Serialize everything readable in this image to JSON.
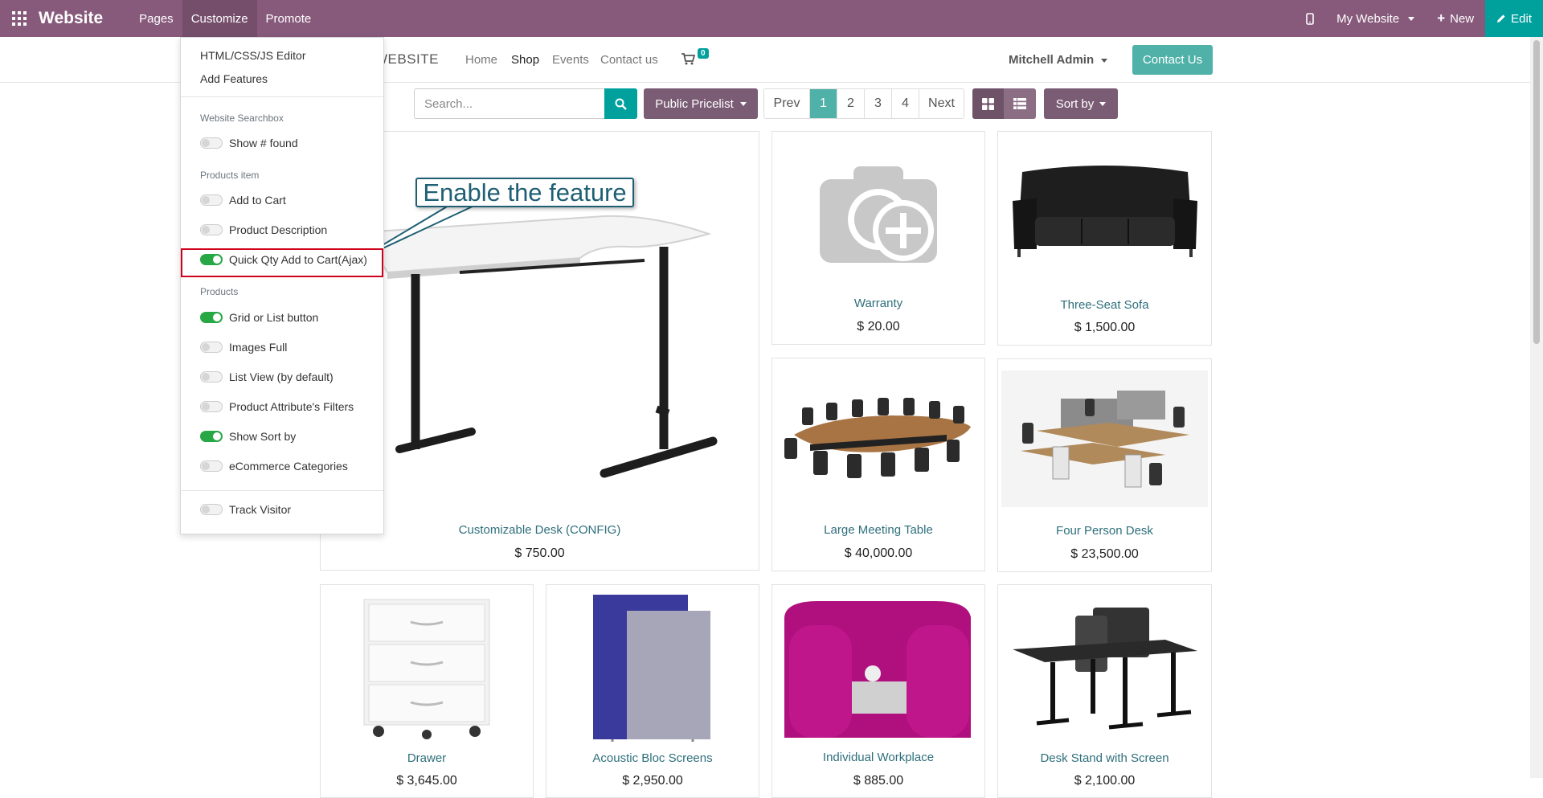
{
  "topbar": {
    "brand": "Website",
    "menus": [
      "Pages",
      "Customize",
      "Promote"
    ],
    "my_website": "My Website",
    "new_label": "New",
    "edit_label": "Edit"
  },
  "sitenav": {
    "logo": "WEBSITE",
    "links": [
      "Home",
      "Shop",
      "Events",
      "Contact us"
    ],
    "cart_count": "0",
    "user": "Mitchell Admin",
    "contact_button": "Contact Us"
  },
  "toolbar": {
    "search_placeholder": "Search...",
    "pricelist": "Public Pricelist",
    "pager": [
      "Prev",
      "1",
      "2",
      "3",
      "4",
      "Next"
    ],
    "current_page": "1",
    "sort": "Sort by"
  },
  "dropdown": {
    "editor": "HTML/CSS/JS Editor",
    "add_features": "Add Features",
    "section_searchbox": "Website Searchbox",
    "show_found": "Show # found",
    "section_products_item": "Products item",
    "add_to_cart": "Add to Cart",
    "product_description": "Product Description",
    "quick_qty": "Quick Qty Add to Cart(Ajax)",
    "section_products": "Products",
    "grid_list": "Grid or List button",
    "images_full": "Images Full",
    "list_view": "List View (by default)",
    "attr_filters": "Product Attribute's Filters",
    "show_sort": "Show Sort by",
    "ecom_categories": "eCommerce Categories",
    "track_visitor": "Track Visitor",
    "toggle_states": {
      "show_found": false,
      "add_to_cart": false,
      "product_description": false,
      "quick_qty": true,
      "grid_list": true,
      "images_full": false,
      "list_view": false,
      "attr_filters": false,
      "show_sort": true,
      "ecom_categories": false,
      "track_visitor": false
    }
  },
  "callout": "Enable the feature",
  "products": [
    {
      "name": "Customizable Desk (CONFIG)",
      "price": "$ 750.00"
    },
    {
      "name": "Warranty",
      "price": "$ 20.00"
    },
    {
      "name": "Three-Seat Sofa",
      "price": "$ 1,500.00"
    },
    {
      "name": "Large Meeting Table",
      "price": "$ 40,000.00"
    },
    {
      "name": "Four Person Desk",
      "price": "$ 23,500.00"
    },
    {
      "name": "Drawer",
      "price": "$ 3,645.00"
    },
    {
      "name": "Acoustic Bloc Screens",
      "price": "$ 2,950.00"
    },
    {
      "name": "Individual Workplace",
      "price": "$ 885.00"
    },
    {
      "name": "Desk Stand with Screen",
      "price": "$ 2,100.00"
    }
  ],
  "colors": {
    "topbar": "#875a7b",
    "accent": "#00a09d",
    "highlight": "#d0021b",
    "callout": "#1f5f73"
  }
}
